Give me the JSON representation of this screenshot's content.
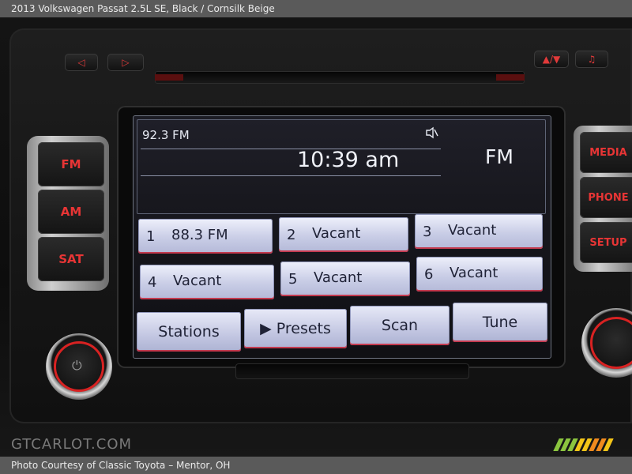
{
  "caption": {
    "title": "2013 Volkswagen Passat 2.5L SE,  Black / Cornsilk Beige",
    "credit": "Photo Courtesy of Classic Toyota – Mentor, OH"
  },
  "head_unit": {
    "top_buttons": {
      "seek_back": "◁",
      "seek_forward": "▷",
      "eject": "▲/▼",
      "music": "♫"
    },
    "left_buttons": [
      "FM",
      "AM",
      "SAT"
    ],
    "right_buttons": [
      "MEDIA",
      "PHONE",
      "SETUP"
    ],
    "screen": {
      "station": "92.3 FM",
      "time": "10:39 am",
      "band": "FM",
      "presets": [
        {
          "number": "1",
          "label": "88.3 FM"
        },
        {
          "number": "2",
          "label": "Vacant"
        },
        {
          "number": "3",
          "label": "Vacant"
        },
        {
          "number": "4",
          "label": "Vacant"
        },
        {
          "number": "5",
          "label": "Vacant"
        },
        {
          "number": "6",
          "label": "Vacant"
        }
      ],
      "softkeys": [
        "Stations",
        "▶ Presets",
        "Scan",
        "Tune"
      ]
    },
    "knob_glyph": "⏻"
  },
  "watermark": "GTCARLOT.COM",
  "colors": {
    "button_text": "#e83535",
    "screen_bg": "#17171d",
    "preset_bg": "#c9cde6",
    "accent_red": "#c43a4f",
    "stripe_green": "#8bc53f",
    "stripe_yellow": "#f4c518",
    "stripe_orange": "#f08a1e"
  }
}
